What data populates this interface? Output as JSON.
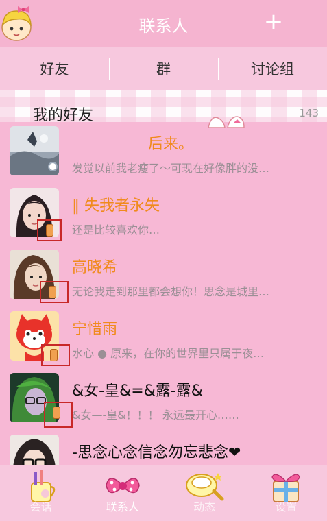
{
  "header": {
    "title": "联系人",
    "add_label": "+"
  },
  "tabs": [
    {
      "label": "好友"
    },
    {
      "label": "群"
    },
    {
      "label": "讨论组"
    }
  ],
  "group": {
    "title": "我的好友",
    "count": "143"
  },
  "contacts": [
    {
      "name": "后来。",
      "signature": "发觉以前我老瘦了～可现在好像胖的没…",
      "name_color": "orange"
    },
    {
      "name": "‖ 失我者永失",
      "signature": "还是比较喜欢你…",
      "name_color": "orange"
    },
    {
      "name": "高晓希",
      "signature": "无论我走到那里都会想你！思念是城里…",
      "name_color": "orange"
    },
    {
      "name": "宁惜雨",
      "signature": "水心 ● 原来，在你的世界里只属于夜…",
      "name_color": "orange"
    },
    {
      "name": "&女-皇&=&露-露&",
      "signature": "&女—-皇&！！！ 永远最开心……",
      "name_color": "dark"
    },
    {
      "name": "-思念心念信念勿忘悲念❤",
      "signature": "",
      "name_color": "dark"
    }
  ],
  "bottom_nav": [
    {
      "label": "会话",
      "icon": "cup-icon"
    },
    {
      "label": "联系人",
      "icon": "bow-icon"
    },
    {
      "label": "动态",
      "icon": "brush-icon"
    },
    {
      "label": "设置",
      "icon": "gift-icon"
    }
  ],
  "colors": {
    "header_bg": "#f5b4d0",
    "list_bg": "#f7b8d5",
    "name_orange": "#f08a1c",
    "badge_border": "#c82828"
  }
}
